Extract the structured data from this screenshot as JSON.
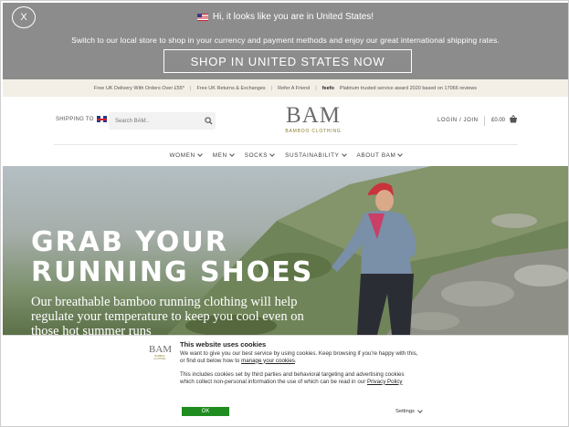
{
  "geo_banner": {
    "close_label": "X",
    "message": "Hi, it looks like you are in United States!",
    "subtext": "Switch to our local store to shop in your currency and payment methods and enjoy our great international shipping rates.",
    "button_label": "SHOP IN UNITED STATES NOW",
    "background_color": "#8c8c8c"
  },
  "info_strip": {
    "items": [
      "Free UK Delivery With Orders Over £55*",
      "Free UK Returns & Exchanges",
      "Refer A Friend"
    ],
    "feefo_brand": "feefo",
    "feefo_text": "Platinum trusted service award 2020 based on 17066 reviews"
  },
  "header": {
    "shipping_label": "SHIPPING TO",
    "search_placeholder": "Search BAM..",
    "logo_main": "BAM",
    "logo_sub": "BAMBOO CLOTHING",
    "login_label": "LOGIN / JOIN",
    "cart_total": "£0.00"
  },
  "nav": {
    "items": [
      "WOMEN",
      "MEN",
      "SOCKS",
      "SUSTAINABILITY",
      "ABOUT BAM"
    ]
  },
  "hero": {
    "title_line1": "GRAB YOUR",
    "title_line2": "RUNNING SHOES",
    "text": "Our breathable bamboo running clothing will help regulate your temperature to keep you cool even on those hot summer runs"
  },
  "cookie_banner": {
    "logo_main": "BAM",
    "logo_sub": "BAMBOO CLOTHING",
    "title": "This website uses cookies",
    "p1_text": "We want to give you our best service by using cookies. Keep browsing if you're happy with this, or find out below how to ",
    "p1_link": "manage your cookies",
    "p1_end": ".",
    "p2_text": "This includes cookies set by third parties and behavioral targeting and advertising cookies which collect non-personal information the use of which can be read in our ",
    "p2_link": "Privacy Policy",
    "ok_label": "OK",
    "settings_label": "Settings",
    "ok_color": "#1e8c1e"
  }
}
